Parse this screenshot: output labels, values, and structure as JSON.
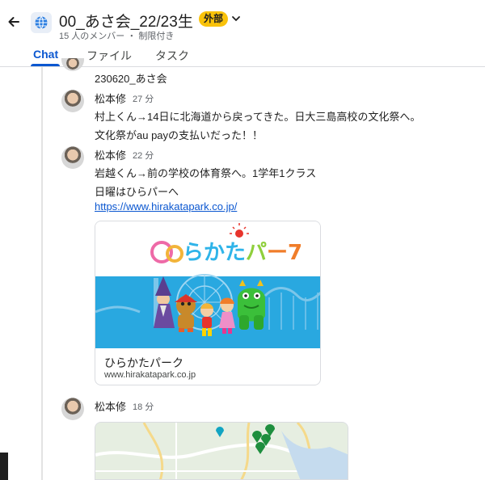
{
  "header": {
    "title": "00_あさ会_22/23生",
    "external_badge": "外部",
    "subtitle": "15 人のメンバー ・ 制限付き",
    "icons": {
      "back": "arrow-back-icon",
      "space": "globe-icon",
      "caret": "chevron-down-icon"
    }
  },
  "tabs": [
    {
      "label": "Chat",
      "active": true
    },
    {
      "label": "ファイル",
      "active": false
    },
    {
      "label": "タスク",
      "active": false
    }
  ],
  "messages": [
    {
      "text_lines": [
        "230620_あさ会"
      ]
    },
    {
      "sender": "松本修",
      "time": "27 分",
      "text_lines": [
        "村上くん→14日に北海道から戻ってきた。日大三島高校の文化祭へ。",
        "文化祭がau payの支払いだった！！"
      ]
    },
    {
      "sender": "松本修",
      "time": "22 分",
      "text_lines": [
        "岩越くん→前の学校の体育祭へ。1学年1クラス",
        "日曜はひらパーへ"
      ],
      "link": "https://www.hirakatapark.co.jp/"
    },
    {
      "sender": "松本修",
      "time": "18 分"
    }
  ],
  "link_preview": {
    "title": "ひらかたパーク",
    "url": "www.hirakatapark.co.jp",
    "logo_text": "ひらかたパーク"
  },
  "colors": {
    "accent": "#0b57d0",
    "badge": "#f9c20a",
    "preview_sky": "#29a8e0"
  }
}
